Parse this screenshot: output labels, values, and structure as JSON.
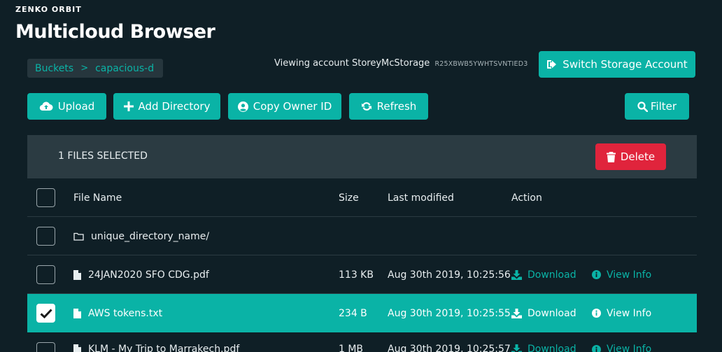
{
  "brand": "ZENKO ORBIT",
  "page_title": "Multicloud Browser",
  "breadcrumb": {
    "root": "Buckets",
    "separator": ">",
    "current": "capacious-d"
  },
  "account": {
    "label": "Viewing account StoreyMcStorage",
    "id": "R25XBWB5YWHTSVNTIED3"
  },
  "buttons": {
    "switch_account": "Switch Storage Account",
    "upload": "Upload",
    "add_directory": "Add Directory",
    "copy_owner_id": "Copy Owner ID",
    "refresh": "Refresh",
    "filter": "Filter",
    "delete": "Delete"
  },
  "selection": {
    "text": "1 FILES SELECTED"
  },
  "table": {
    "headers": {
      "name": "File Name",
      "size": "Size",
      "modified": "Last modified",
      "action": "Action"
    },
    "rows": [
      {
        "type": "folder",
        "name": "unique_directory_name/",
        "size": "",
        "modified": "",
        "selected": false
      },
      {
        "type": "file",
        "name": "24JAN2020 SFO CDG.pdf",
        "size": "113 KB",
        "modified": "Aug 30th 2019, 10:25:56",
        "download": "Download",
        "view_info": "View Info",
        "selected": false
      },
      {
        "type": "file",
        "name": "AWS tokens.txt",
        "size": "234 B",
        "modified": "Aug 30th 2019, 10:25:55",
        "download": "Download",
        "view_info": "View Info",
        "selected": true
      },
      {
        "type": "file",
        "name": "KLM - My Trip to Marrakech.pdf",
        "size": "1 MB",
        "modified": "Aug 30th 2019, 10:25:57",
        "download": "Download",
        "view_info": "View Info",
        "selected": false
      }
    ]
  },
  "colors": {
    "background": "#0f1f26",
    "accent": "#0ab3a6",
    "danger": "#e0243c",
    "panel": "#2b3b42"
  }
}
